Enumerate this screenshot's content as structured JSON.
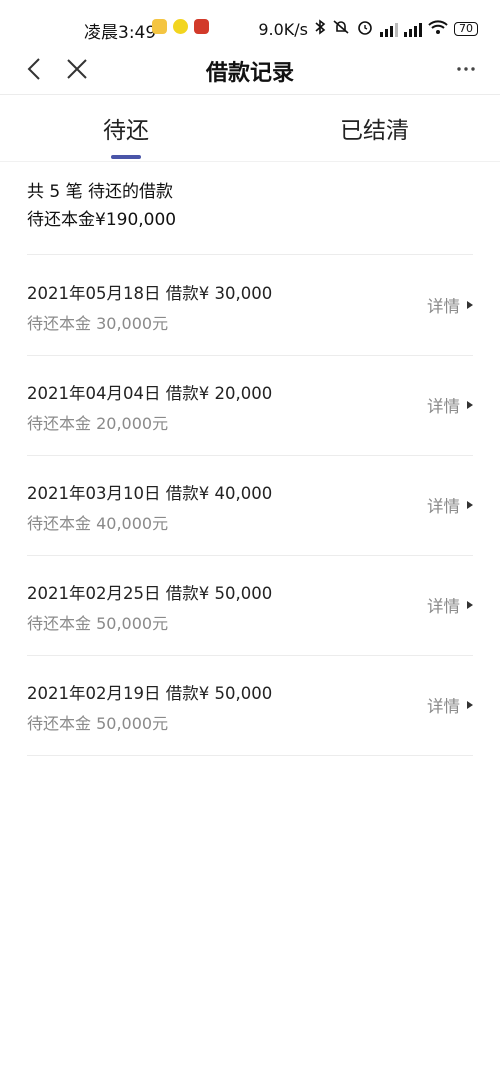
{
  "status_bar": {
    "time": "凌晨3:49",
    "net_speed": "9.0K/s",
    "battery": "70",
    "app_icon_colors": [
      "#f4c542",
      "#f2d51f",
      "#d23a2a"
    ]
  },
  "nav": {
    "title": "借款记录",
    "back_icon": "chevron-left-icon",
    "close_icon": "close-icon",
    "more_icon": "more-dots-icon"
  },
  "tabs": [
    {
      "label": "待还",
      "active": true
    },
    {
      "label": "已结清",
      "active": false
    }
  ],
  "accent_color": "#4a55a8",
  "summary": {
    "count_text": "共 5 笔 待还的借款",
    "total_text": "待还本金¥190,000"
  },
  "loans": [
    {
      "title": "2021年05月18日 借款¥ 30,000",
      "remaining": "待还本金 30,000元",
      "detail": "详情"
    },
    {
      "title": "2021年04月04日 借款¥ 20,000",
      "remaining": "待还本金 20,000元",
      "detail": "详情"
    },
    {
      "title": "2021年03月10日 借款¥ 40,000",
      "remaining": "待还本金 40,000元",
      "detail": "详情"
    },
    {
      "title": "2021年02月25日 借款¥ 50,000",
      "remaining": "待还本金 50,000元",
      "detail": "详情"
    },
    {
      "title": "2021年02月19日 借款¥ 50,000",
      "remaining": "待还本金 50,000元",
      "detail": "详情"
    }
  ]
}
